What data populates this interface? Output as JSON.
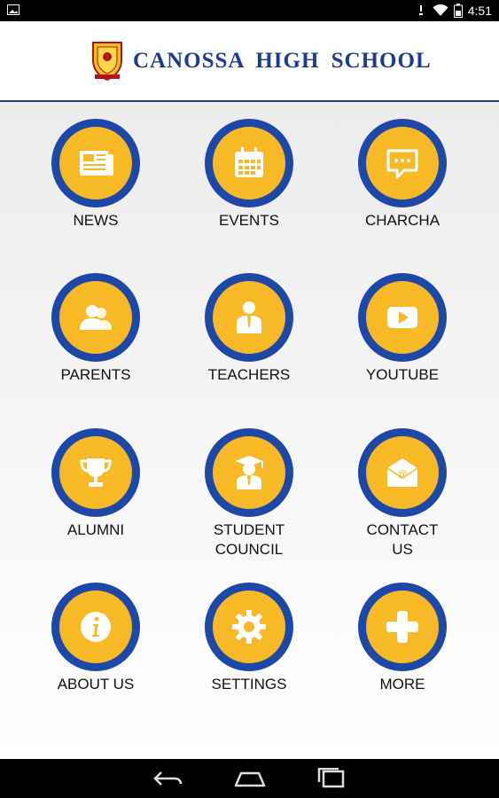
{
  "status": {
    "time": "4:51"
  },
  "header": {
    "title": "CANOSSA HIGH SCHOOL"
  },
  "tiles": [
    {
      "label": "NEWS",
      "icon": "newspaper-icon"
    },
    {
      "label": "EVENTS",
      "icon": "calendar-icon"
    },
    {
      "label": "CHARCHA",
      "icon": "chat-bubble-icon"
    },
    {
      "label": "PARENTS",
      "icon": "users-icon"
    },
    {
      "label": "TEACHERS",
      "icon": "teacher-icon"
    },
    {
      "label": "YOUTUBE",
      "icon": "play-icon"
    },
    {
      "label": "ALUMNI",
      "icon": "trophy-icon"
    },
    {
      "label": "STUDENT\nCOUNCIL",
      "icon": "graduate-icon"
    },
    {
      "label": "CONTACT\nUS",
      "icon": "mail-icon"
    },
    {
      "label": "ABOUT US",
      "icon": "info-icon"
    },
    {
      "label": "SETTINGS",
      "icon": "gear-icon"
    },
    {
      "label": "MORE",
      "icon": "plus-icon"
    }
  ],
  "colors": {
    "accent": "#f8b927",
    "ring": "#1e48a8",
    "brand": "#1f3a93"
  }
}
